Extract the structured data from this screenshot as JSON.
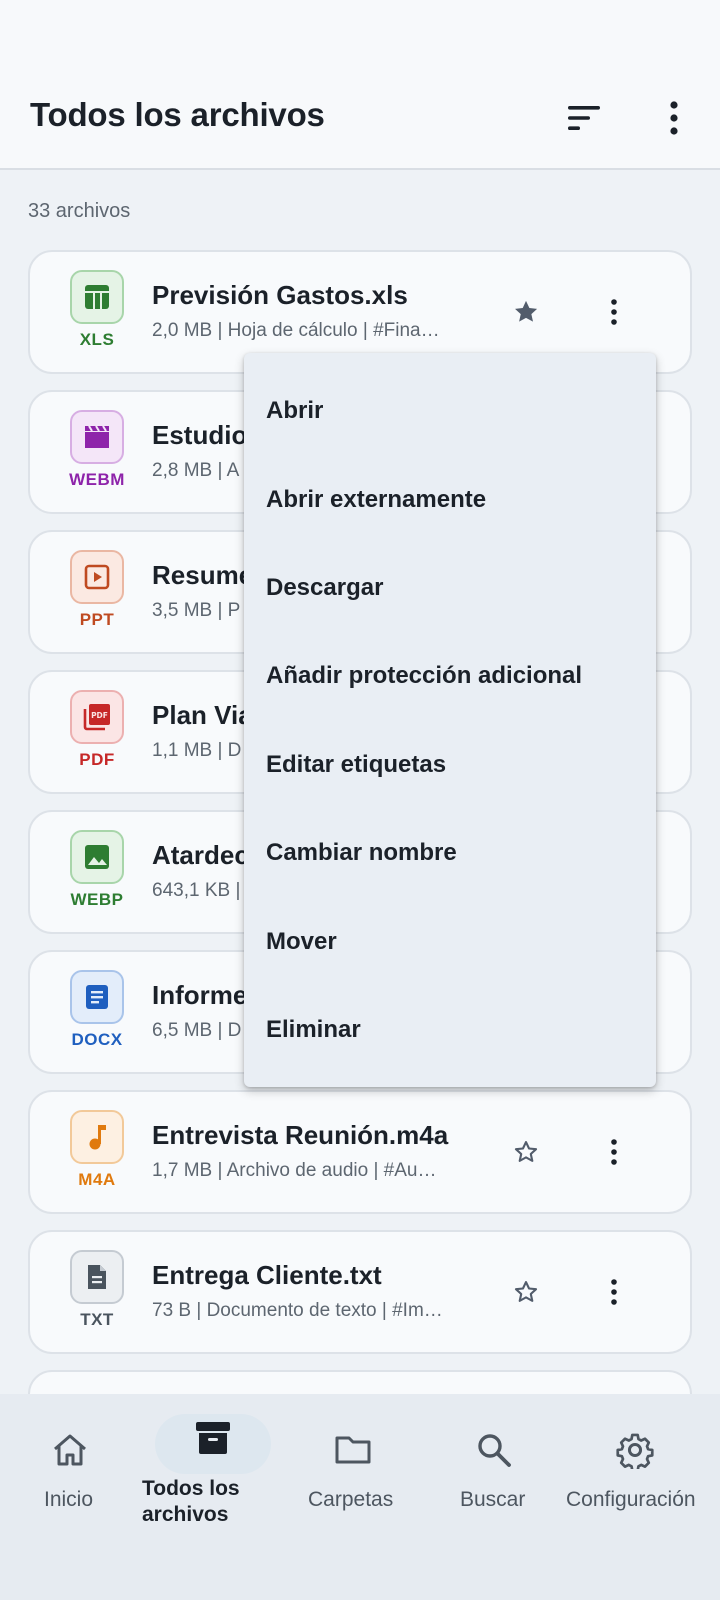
{
  "header": {
    "title": "Todos los archivos",
    "sort_icon": "sort-icon",
    "more_icon": "more-vert-icon"
  },
  "file_count": "33 archivos",
  "files": [
    {
      "name": "Previsión Gastos.xls",
      "meta": "2,0 MB | Hoja de cálculo | #Fina…",
      "type": "XLS",
      "icon": "table-icon",
      "color": "#2e7d32",
      "bg": "#e5f3e6",
      "border": "#a8d5aa",
      "starred": true
    },
    {
      "name": "Estudio",
      "meta": "2,8 MB | A",
      "type": "WEBM",
      "icon": "movie-icon",
      "color": "#8e24aa",
      "bg": "#f4e6f8",
      "border": "#d7aee3",
      "starred": false
    },
    {
      "name": "Resume",
      "meta": "3,5 MB | P",
      "type": "PPT",
      "icon": "slideshow-icon",
      "color": "#bf4a21",
      "bg": "#fbe9e2",
      "border": "#eab7a3",
      "starred": false
    },
    {
      "name": "Plan Via",
      "meta": "1,1 MB | D",
      "type": "PDF",
      "icon": "pdf-icon",
      "color": "#c62828",
      "bg": "#fbe5e5",
      "border": "#ecb0b0",
      "starred": false
    },
    {
      "name": "Atardec",
      "meta": "643,1 KB |",
      "type": "WEBP",
      "icon": "image-icon",
      "color": "#2e7d32",
      "bg": "#e5f3e6",
      "border": "#a8d5aa",
      "starred": false
    },
    {
      "name": "Informe",
      "meta": "6,5 MB | D",
      "type": "DOCX",
      "icon": "document-icon",
      "color": "#1f5fbf",
      "bg": "#e3edfa",
      "border": "#a9c4ea",
      "starred": false
    },
    {
      "name": "Entrevista Reunión.m4a",
      "meta": "1,7 MB | Archivo de audio | #Au…",
      "type": "M4A",
      "icon": "music-note-icon",
      "color": "#e07a0e",
      "bg": "#fdf0e2",
      "border": "#f2c999",
      "starred": false
    },
    {
      "name": "Entrega Cliente.txt",
      "meta": "73 B | Documento de texto | #Im…",
      "type": "TXT",
      "icon": "text-file-icon",
      "color": "#4a545e",
      "bg": "#eceff2",
      "border": "#c5cbd2",
      "starred": false
    }
  ],
  "menu": {
    "items": [
      "Abrir",
      "Abrir externamente",
      "Descargar",
      "Añadir protección adicional",
      "Editar etiquetas",
      "Cambiar nombre",
      "Mover",
      "Eliminar"
    ]
  },
  "nav": {
    "items": [
      {
        "label": "Inicio",
        "icon": "home-icon",
        "active": false
      },
      {
        "label": "Todos los archivos",
        "icon": "archive-icon",
        "active": true
      },
      {
        "label": "Carpetas",
        "icon": "folder-icon",
        "active": false
      },
      {
        "label": "Buscar",
        "icon": "search-icon",
        "active": false
      },
      {
        "label": "Configuración",
        "icon": "settings-icon",
        "active": false
      }
    ]
  }
}
